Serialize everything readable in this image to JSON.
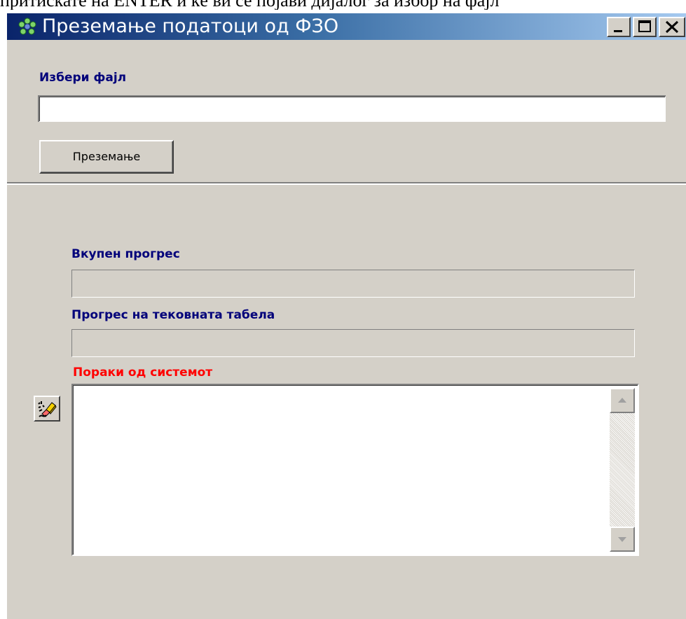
{
  "caption": "притискате на ENTER и ќе ви се појави дијалог за избор на фајл",
  "window": {
    "title": "Преземање податоци од ФЗО",
    "controls": {
      "minimize": "minimize-icon",
      "maximize": "maximize-icon",
      "close": "close-icon"
    }
  },
  "file_section": {
    "label": "Избери фајл",
    "value": "",
    "download_button": "Преземање"
  },
  "progress": {
    "total_label": "Вкупен прогрес",
    "total_value": 0,
    "table_label": "Прогрес на тековната табела",
    "table_value": 0
  },
  "messages": {
    "label": "Пораки од системот",
    "content": "",
    "clear_icon": "eraser-icon"
  },
  "colors": {
    "title_gradient_start": "#0a246a",
    "title_gradient_end": "#a6caf0",
    "label_blue": "#00007a",
    "label_red": "#ff0000",
    "window_face": "#d4d0c8"
  }
}
